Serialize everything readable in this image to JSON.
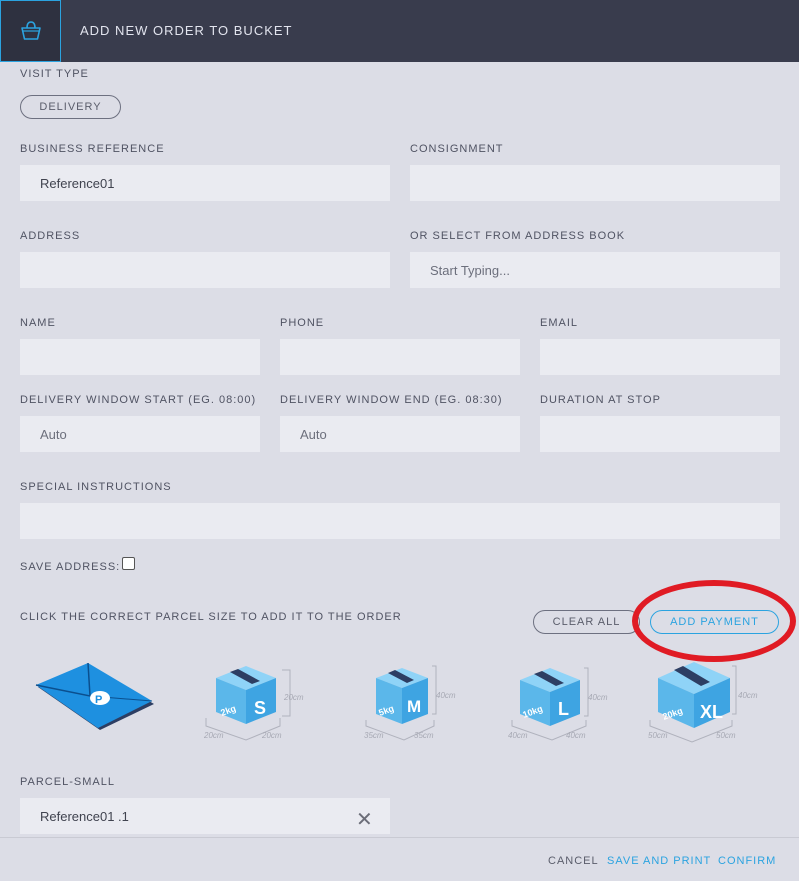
{
  "header": {
    "title": "ADD NEW ORDER TO BUCKET",
    "icon": "basket-icon"
  },
  "visit_type": {
    "label": "VISIT TYPE",
    "value": "DELIVERY"
  },
  "business_reference": {
    "label": "BUSINESS REFERENCE",
    "value": "Reference01"
  },
  "consignment": {
    "label": "CONSIGNMENT",
    "value": ""
  },
  "address": {
    "label": "ADDRESS",
    "value": ""
  },
  "address_book": {
    "label": "OR SELECT FROM ADDRESS BOOK",
    "placeholder": "Start Typing..."
  },
  "name": {
    "label": "NAME",
    "value": ""
  },
  "phone": {
    "label": "PHONE",
    "value": ""
  },
  "email": {
    "label": "EMAIL",
    "value": ""
  },
  "window_start": {
    "label": "DELIVERY WINDOW START (EG. 08:00)",
    "placeholder": "Auto"
  },
  "window_end": {
    "label": "DELIVERY WINDOW END (EG. 08:30)",
    "placeholder": "Auto"
  },
  "duration": {
    "label": "DURATION AT STOP",
    "value": ""
  },
  "special_instructions": {
    "label": "SPECIAL INSTRUCTIONS",
    "value": ""
  },
  "save_address": {
    "label": "SAVE ADDRESS:",
    "checked": false
  },
  "parcel_prompt": "CLICK THE CORRECT PARCEL SIZE TO ADD IT TO THE ORDER",
  "buttons": {
    "clear_all": "CLEAR ALL",
    "add_payment": "ADD PAYMENT"
  },
  "parcels": [
    {
      "name": "envelope",
      "letter": ""
    },
    {
      "name": "S",
      "weight": "2kg",
      "letter": "S",
      "w": "20cm",
      "d": "20cm",
      "h": "20cm"
    },
    {
      "name": "M",
      "weight": "5kg",
      "letter": "M",
      "w": "35cm",
      "d": "35cm",
      "h": "40cm"
    },
    {
      "name": "L",
      "weight": "10kg",
      "letter": "L",
      "w": "40cm",
      "d": "40cm",
      "h": "40cm"
    },
    {
      "name": "XL",
      "weight": "20kg",
      "letter": "XL",
      "w": "50cm",
      "d": "50cm",
      "h": "40cm"
    }
  ],
  "parcel_small": {
    "label": "PARCEL-SMALL",
    "value": "Reference01 .1"
  },
  "footer": {
    "cancel": "CANCEL",
    "save_print": "SAVE AND PRINT",
    "confirm": "CONFIRM"
  },
  "colors": {
    "accent": "#2ba3e0",
    "header_bg": "#393c4d",
    "highlight": "#e01b24",
    "page_bg": "#dcdde6"
  }
}
